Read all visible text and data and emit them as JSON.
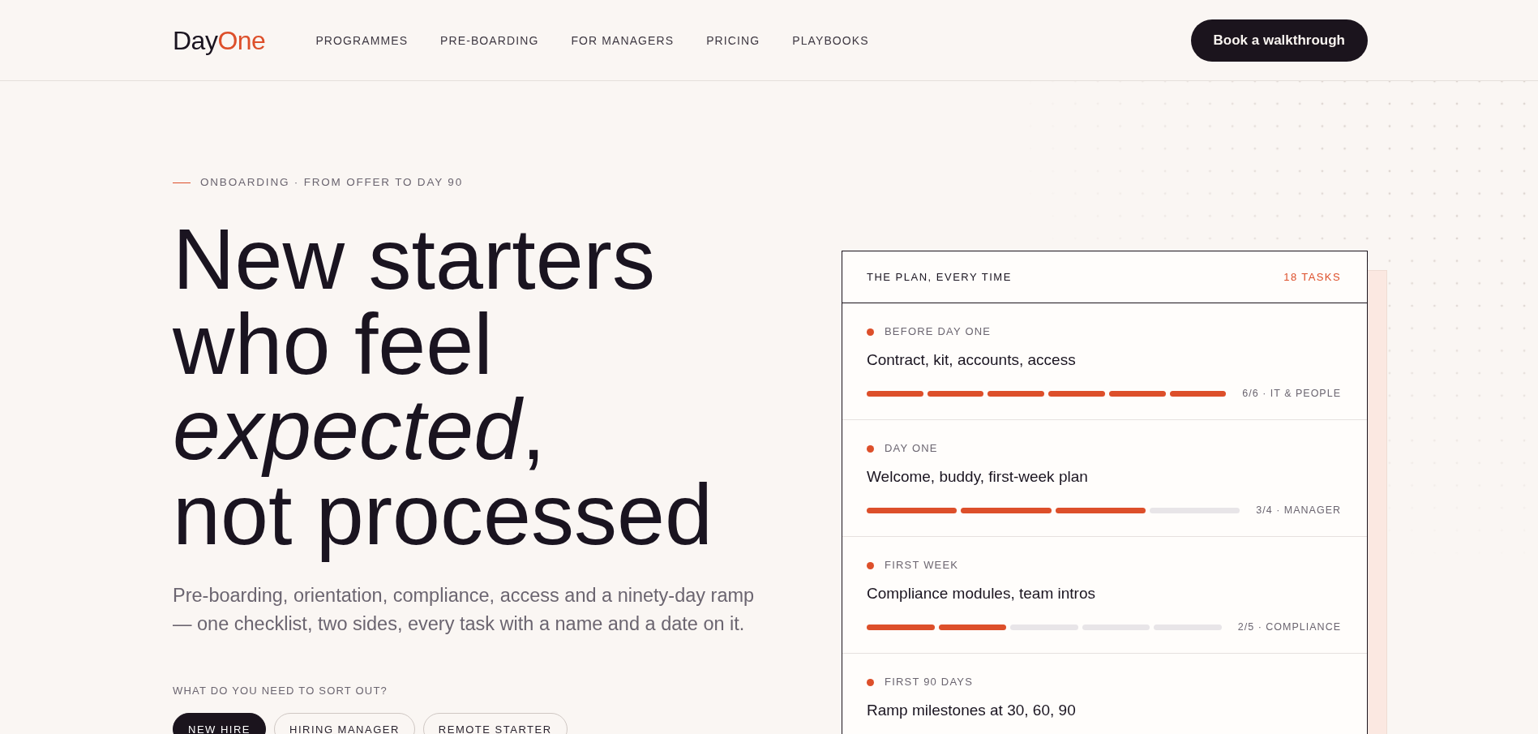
{
  "header": {
    "logo": [
      "Day",
      "One"
    ],
    "nav": [
      "PROGRAMMES",
      "PRE-BOARDING",
      "FOR MANAGERS",
      "PRICING",
      "PLAYBOOKS"
    ],
    "cta": "Book a walkthrough"
  },
  "hero": {
    "eyebrow": "ONBOARDING · FROM OFFER TO DAY 90",
    "headline": [
      "New starters",
      "who feel",
      "*expected*,",
      "not processed"
    ],
    "intro": "Pre-boarding, orientation, compliance, access and a ninety-day ramp — one checklist, two sides, every task with a name and a date on it.",
    "question": "WHAT DO YOU NEED TO SORT OUT?",
    "options": [
      {
        "label": "NEW HIRE",
        "selected": true
      },
      {
        "label": "HIRING MANAGER",
        "selected": false
      },
      {
        "label": "REMOTE STARTER",
        "selected": false
      }
    ]
  },
  "plan_card": {
    "title": "THE PLAN, EVERY TIME",
    "count": "18 TASKS",
    "stages": [
      {
        "label": "BEFORE DAY ONE",
        "title": "Contract, kit, accounts, access",
        "segments": [
          {
            "done": true
          },
          {
            "done": true
          },
          {
            "done": true
          },
          {
            "done": true
          },
          {
            "done": true
          },
          {
            "done": true
          }
        ],
        "meta": "6/6 · IT & PEOPLE"
      },
      {
        "label": "DAY ONE",
        "title": "Welcome, buddy, first-week plan",
        "segments": [
          {
            "done": true
          },
          {
            "done": true
          },
          {
            "done": true
          },
          {
            "done": false
          }
        ],
        "meta": "3/4 · MANAGER"
      },
      {
        "label": "FIRST WEEK",
        "title": "Compliance modules, team intros",
        "segments": [
          {
            "done": true
          },
          {
            "done": true
          },
          {
            "done": false
          },
          {
            "done": false
          },
          {
            "done": false
          }
        ],
        "meta": "2/5 · COMPLIANCE"
      },
      {
        "label": "FIRST 90 DAYS",
        "title": "Ramp milestones at 30, 60, 90"
      }
    ]
  }
}
